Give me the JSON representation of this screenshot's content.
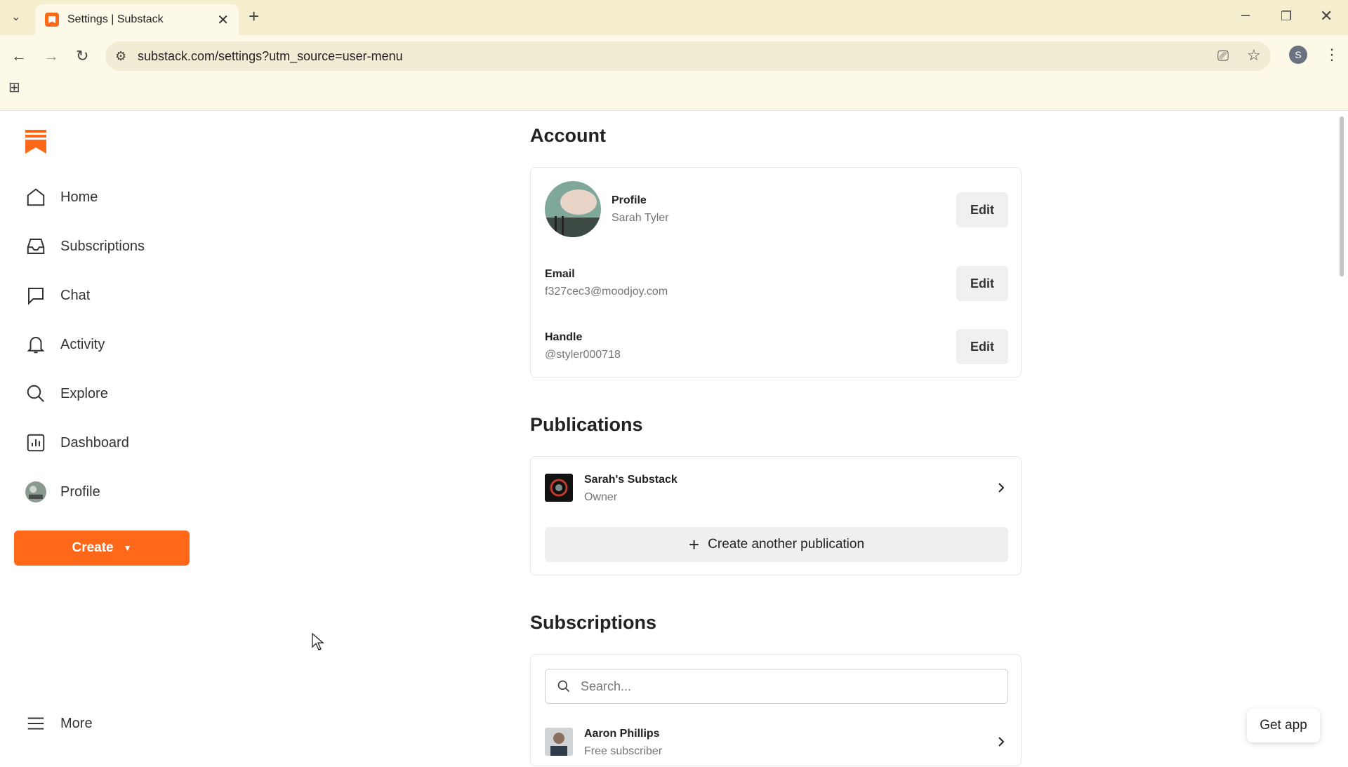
{
  "browser": {
    "tab_title": "Settings | Substack",
    "url": "substack.com/settings?utm_source=user-menu",
    "profile_initial": "S"
  },
  "sidebar": {
    "items": [
      {
        "label": "Home",
        "icon": "home-icon"
      },
      {
        "label": "Subscriptions",
        "icon": "inbox-icon"
      },
      {
        "label": "Chat",
        "icon": "chat-icon"
      },
      {
        "label": "Activity",
        "icon": "bell-icon"
      },
      {
        "label": "Explore",
        "icon": "search-icon"
      },
      {
        "label": "Dashboard",
        "icon": "chart-icon"
      },
      {
        "label": "Profile",
        "icon": "avatar"
      }
    ],
    "create_label": "Create",
    "more_label": "More"
  },
  "account": {
    "heading": "Account",
    "profile": {
      "label": "Profile",
      "value": "Sarah Tyler"
    },
    "email": {
      "label": "Email",
      "value": "f327cec3@moodjoy.com"
    },
    "handle": {
      "label": "Handle",
      "value": "@styler000718"
    },
    "edit_label": "Edit"
  },
  "publications": {
    "heading": "Publications",
    "items": [
      {
        "name": "Sarah's Substack",
        "role": "Owner"
      }
    ],
    "create_label": "Create another publication"
  },
  "subscriptions": {
    "heading": "Subscriptions",
    "search_placeholder": "Search...",
    "items": [
      {
        "name": "Aaron Phillips",
        "status": "Free subscriber"
      }
    ]
  },
  "get_app_label": "Get app",
  "colors": {
    "accent": "#ff6719"
  }
}
